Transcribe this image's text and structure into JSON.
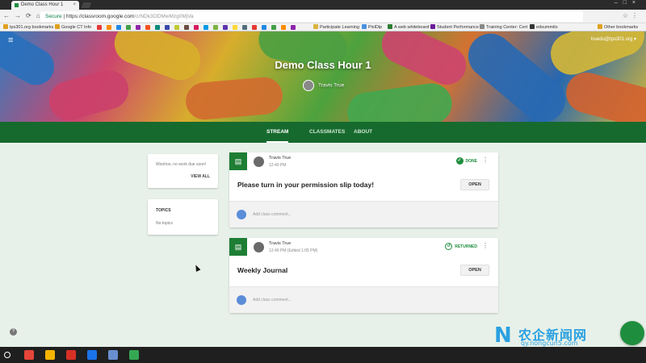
{
  "browser": {
    "tab_title": "Demo Class Hour 1",
    "tab_close": "×",
    "window_controls": "–□×",
    "nav_glyphs": "←→⟳⌂",
    "secure_label": "Secure",
    "url_host": "https://classroom.google.com",
    "url_path": "/c/NDk3ODMwMzg0MjVa",
    "addr_icons": "☆⋮",
    "bookmarks": [
      {
        "label": "tps301.org bookmarks",
        "color": "#e0a020"
      },
      {
        "label": "Google CT Info",
        "color": "#e0a020"
      },
      {
        "label": "Participate Learning",
        "color": "#d9b23c"
      },
      {
        "label": "PixlDip",
        "color": "#4a90e2"
      },
      {
        "label": "A web whiteboard",
        "color": "#2e7d32"
      },
      {
        "label": "Student Performance",
        "color": "#6a1b9a"
      },
      {
        "label": "Training Center: Cert",
        "color": "#888888"
      },
      {
        "label": "edsummits",
        "color": "#333333"
      },
      {
        "label": "Other bookmarks",
        "color": "#e0a020"
      }
    ],
    "bookmark_icon_colors": [
      "#e53935",
      "#fb8c00",
      "#1e88e5",
      "#43a047",
      "#8e24aa",
      "#f4511e",
      "#00897b",
      "#3949ab",
      "#c0ca33",
      "#6d4c41",
      "#d81b60",
      "#039be5",
      "#7cb342",
      "#5e35b1",
      "#fdd835",
      "#546e7a",
      "#e53935",
      "#1e88e5",
      "#43a047",
      "#fb8c00",
      "#8e24aa"
    ]
  },
  "header": {
    "menu_glyph": "≡",
    "user_email": "truedu@tps301.org ▾",
    "class_title": "Demo Class Hour 1",
    "teacher_name": "Travis True"
  },
  "tabs": [
    {
      "label": "STREAM",
      "active": true
    },
    {
      "label": "CLASSMATES",
      "active": false
    },
    {
      "label": "ABOUT",
      "active": false
    }
  ],
  "upcoming": {
    "message": "Woohoo, no work due soon!",
    "view_all": "VIEW ALL"
  },
  "topics": {
    "heading": "TOPICS",
    "empty": "No topics"
  },
  "posts": [
    {
      "author": "Travis True",
      "time": "12:40 PM",
      "status": "DONE",
      "title": "Please turn in your permission slip today!",
      "open_label": "OPEN",
      "comment_placeholder": "Add class comment..."
    },
    {
      "author": "Travis True",
      "time": "12:40 PM (Edited 1:05 PM)",
      "status": "RETURNED",
      "title": "Weekly Journal",
      "open_label": "OPEN",
      "comment_placeholder": "Add class comment..."
    }
  ],
  "post_icon_glyph": "▤",
  "kebab_glyph": "⋮",
  "check_glyph": "✓",
  "return_glyph": "↺",
  "help_glyph": "?",
  "watermark": {
    "logo": "N",
    "text": "农企新闻网",
    "url": "qy.nongcun5.com"
  },
  "taskbar": {
    "apps": [
      {
        "name": "chrome",
        "color": "#e6453a"
      },
      {
        "name": "drive",
        "color": "#f4b400"
      },
      {
        "name": "gmail",
        "color": "#d93025"
      },
      {
        "name": "files",
        "color": "#1a73e8"
      },
      {
        "name": "photos",
        "color": "#6a8fd1"
      },
      {
        "name": "cast",
        "color": "#34a853"
      }
    ]
  }
}
